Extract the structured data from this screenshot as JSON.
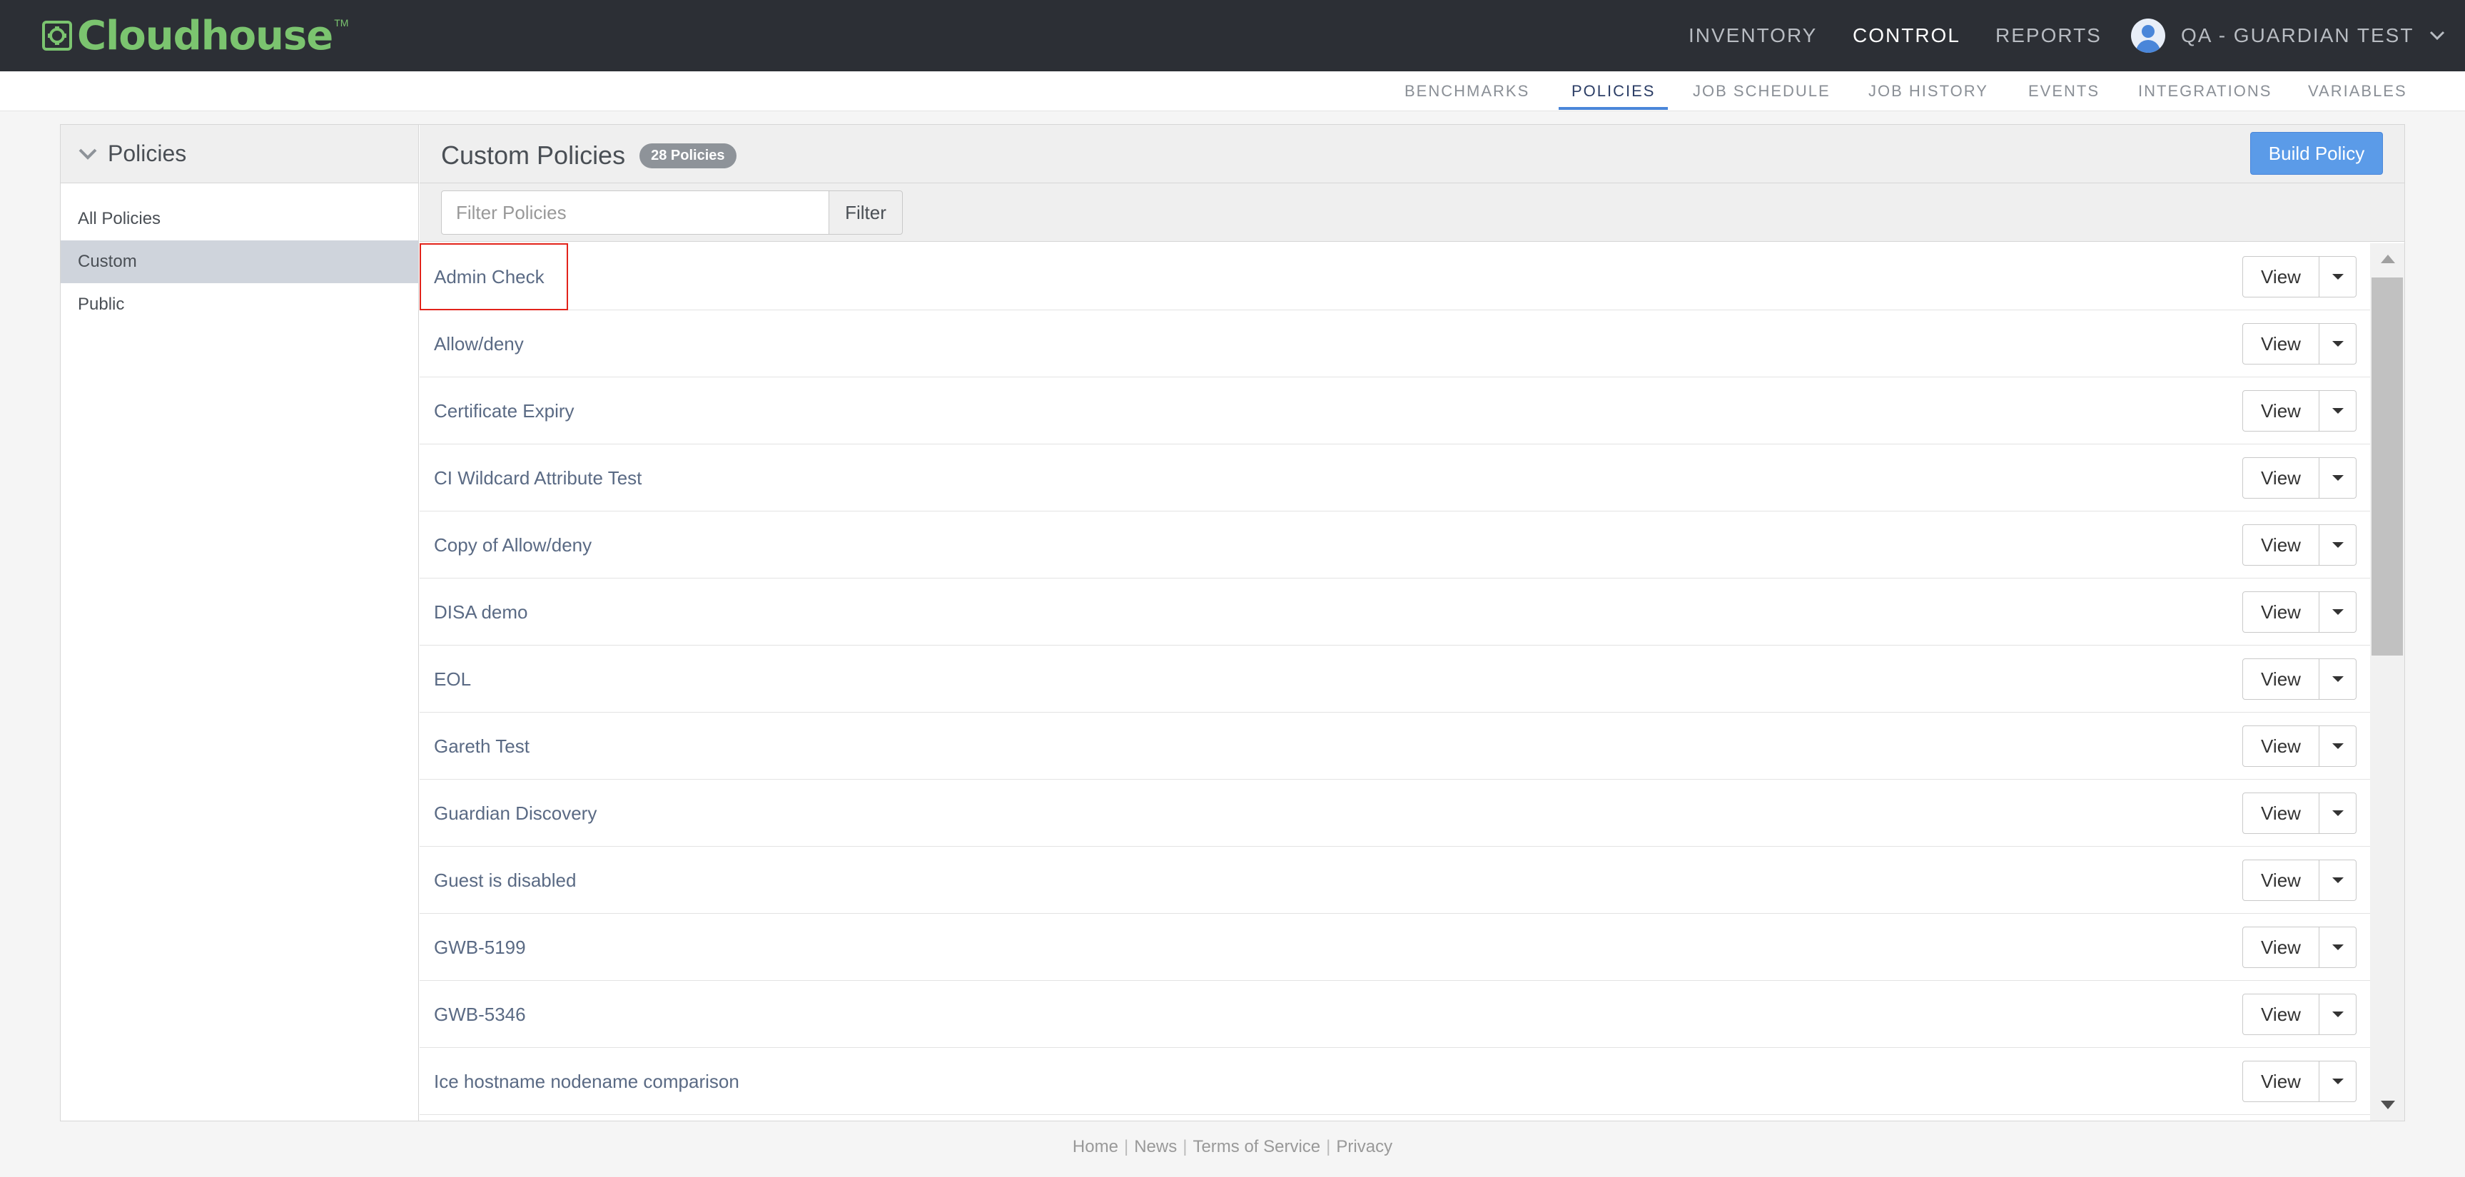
{
  "brand": {
    "name": "Cloudhouse",
    "tm": "TM",
    "color": "#7bc46f"
  },
  "mainnav": {
    "items": [
      "INVENTORY",
      "CONTROL",
      "REPORTS"
    ],
    "active": "CONTROL"
  },
  "user": {
    "label": "QA - GUARDIAN TEST"
  },
  "subnav": {
    "items": [
      "BENCHMARKS",
      "POLICIES",
      "JOB SCHEDULE",
      "JOB HISTORY",
      "EVENTS",
      "INTEGRATIONS",
      "VARIABLES"
    ],
    "active": "POLICIES"
  },
  "sidebar": {
    "title": "Policies",
    "items": [
      "All Policies",
      "Custom",
      "Public"
    ],
    "active": "Custom"
  },
  "content": {
    "title": "Custom Policies",
    "badge": "28 Policies",
    "build_label": "Build Policy",
    "filter_placeholder": "Filter Policies",
    "filter_label": "Filter",
    "view_label": "View"
  },
  "policies": [
    "Admin Check",
    "Allow/deny",
    "Certificate Expiry",
    "CI Wildcard Attribute Test",
    "Copy of Allow/deny",
    "DISA demo",
    "EOL",
    "Gareth Test",
    "Guardian Discovery",
    "Guest is disabled",
    "GWB-5199",
    "GWB-5346",
    "Ice hostname nodename comparison"
  ],
  "highlighted_policy": "Admin Check",
  "footer": {
    "links": [
      "Home",
      "News",
      "Terms of Service",
      "Privacy"
    ]
  },
  "colors": {
    "accent": "#4a86d9",
    "button": "#5b9be8",
    "topbar": "#2c2f35",
    "highlight": "#e2231a"
  }
}
